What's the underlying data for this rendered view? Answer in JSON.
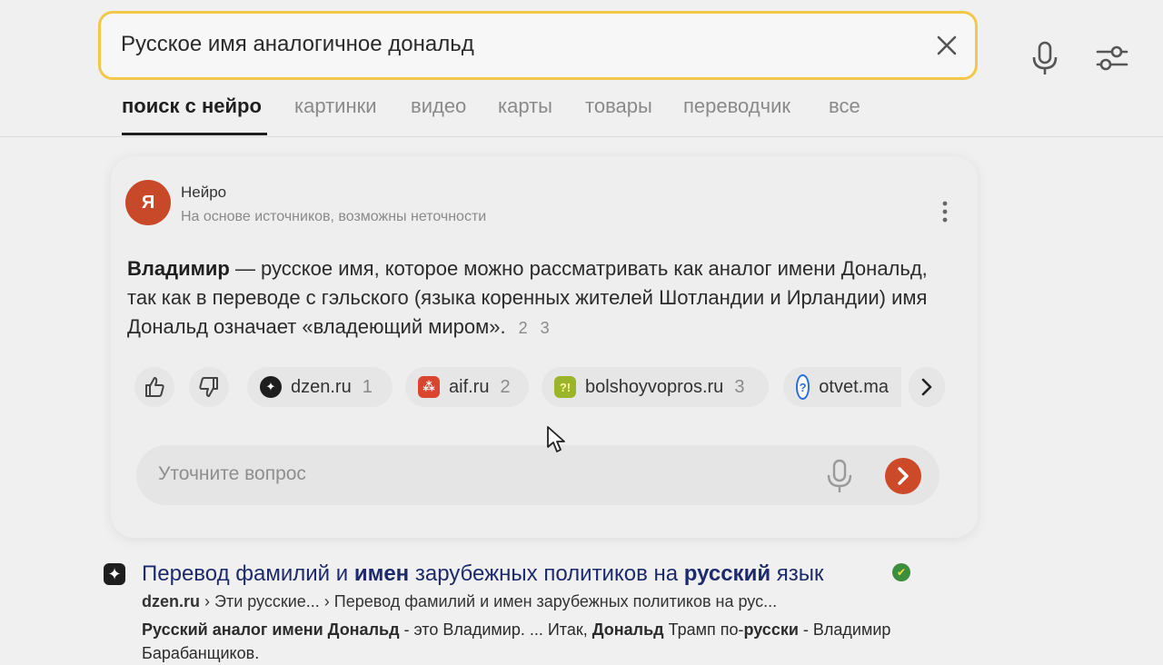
{
  "search": {
    "query": "Русское имя аналогичное дональд"
  },
  "tabs": [
    {
      "label": "поиск с нейро",
      "active": true
    },
    {
      "label": "картинки"
    },
    {
      "label": "видео"
    },
    {
      "label": "карты"
    },
    {
      "label": "товары"
    },
    {
      "label": "переводчик"
    },
    {
      "label": "все"
    }
  ],
  "neyro": {
    "title": "Нейро",
    "subtitle": "На основе источников, возможны неточности",
    "answer_bold": "Владимир",
    "answer_rest": " — русское имя, которое можно рассматривать как аналог имени Дональд, так как в переводе с гэльского (языка коренных жителей Шотландии и Ирландии) имя Дональд означает «владеющий миром».",
    "refs": [
      "2",
      "3"
    ],
    "sources": [
      {
        "name": "dzen.ru",
        "count": "1"
      },
      {
        "name": "aif.ru",
        "count": "2"
      },
      {
        "name": "bolshoyvopros.ru",
        "count": "3"
      },
      {
        "name": "otvet.ma",
        "count": ""
      }
    ],
    "ask_placeholder": "Уточните вопрос"
  },
  "result": {
    "title_parts": [
      {
        "text": "Перевод фамилий и ",
        "bold": false
      },
      {
        "text": "имен",
        "bold": true
      },
      {
        "text": " зарубежных политиков на ",
        "bold": false
      },
      {
        "text": "русский",
        "bold": true
      },
      {
        "text": " язык",
        "bold": false
      }
    ],
    "domain": "dzen.ru",
    "path": " › Эти русские... › Перевод фамилий и имен зарубежных политиков на рус...",
    "snippet_parts": [
      {
        "text": "Русский аналог имени Дональд",
        "bold": true
      },
      {
        "text": " - это Владимир. ... Итак, ",
        "bold": false
      },
      {
        "text": "Дональд",
        "bold": true
      },
      {
        "text": " Трамп по-",
        "bold": false
      },
      {
        "text": "русски",
        "bold": true
      },
      {
        "text": " - Владимир Барабанщиков.",
        "bold": false
      }
    ]
  },
  "colors": {
    "accent_yellow": "#f2c84b",
    "brand_red": "#cc4a28",
    "link_blue": "#1d2a6b"
  }
}
